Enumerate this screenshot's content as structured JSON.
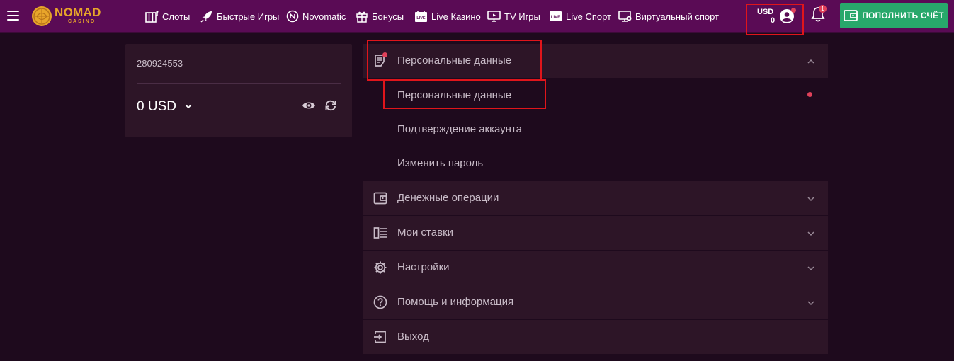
{
  "header": {
    "logo": {
      "name": "NOMAD",
      "sub": "CASINO"
    },
    "nav": [
      {
        "label": "Слоты",
        "icon": "slots-icon"
      },
      {
        "label": "Быстрые Игры",
        "icon": "rocket-icon"
      },
      {
        "label": "Novomatic",
        "icon": "novomatic-icon"
      },
      {
        "label": "Бонусы",
        "icon": "gift-icon"
      },
      {
        "label": "Live Казино",
        "icon": "live-casino-icon"
      },
      {
        "label": "TV Игры",
        "icon": "tv-icon"
      },
      {
        "label": "Live Спорт",
        "icon": "live-sport-icon"
      },
      {
        "label": "Виртуальный спорт",
        "icon": "virtual-sport-icon"
      }
    ],
    "balance": {
      "currency": "USD",
      "amount": "0"
    },
    "notifications_count": "1",
    "deposit_label": "ПОПОЛНИТЬ СЧЁТ"
  },
  "account": {
    "id": "280924553",
    "balance": "0 USD"
  },
  "menu": {
    "personal": {
      "label": "Персональные данные",
      "icon": "document-icon",
      "expanded": true,
      "items": [
        {
          "label": "Персональные данные",
          "active": true
        },
        {
          "label": "Подтверждение аккаунта"
        },
        {
          "label": "Изменить пароль"
        }
      ]
    },
    "sections": [
      {
        "label": "Денежные операции",
        "icon": "wallet-icon"
      },
      {
        "label": "Мои ставки",
        "icon": "bets-list-icon"
      },
      {
        "label": "Настройки",
        "icon": "gear-icon"
      },
      {
        "label": "Помощь и информация",
        "icon": "help-icon"
      }
    ],
    "logout": {
      "label": "Выход",
      "icon": "logout-icon"
    }
  },
  "colors": {
    "header_bg": "#5a0b55",
    "page_bg": "#1e0a1d",
    "panel_bg": "#2d1527",
    "accent_green": "#28a86b",
    "logo_gold": "#e8a52a",
    "badge_red": "#e0415a",
    "highlight_red": "#e0151b"
  }
}
